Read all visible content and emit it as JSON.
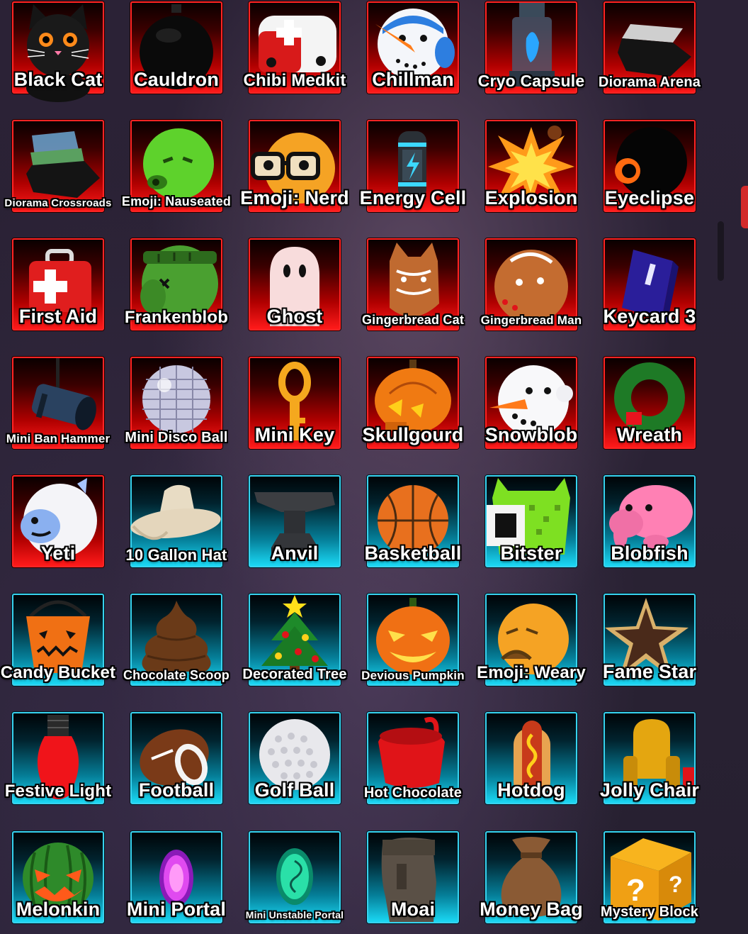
{
  "inventory": {
    "items": [
      {
        "label": "Black Cat",
        "icon": "black-cat-icon",
        "rarity": "red"
      },
      {
        "label": "Cauldron",
        "icon": "cauldron-icon",
        "rarity": "red"
      },
      {
        "label": "Chibi Medkit",
        "icon": "chibi-medkit-icon",
        "rarity": "red"
      },
      {
        "label": "Chillman",
        "icon": "chillman-icon",
        "rarity": "red"
      },
      {
        "label": "Cryo Capsule",
        "icon": "cryo-capsule-icon",
        "rarity": "red"
      },
      {
        "label": "Diorama Arena",
        "icon": "diorama-arena-icon",
        "rarity": "red"
      },
      {
        "label": "Diorama Crossroads",
        "icon": "diorama-crossroads-icon",
        "rarity": "red"
      },
      {
        "label": "Emoji: Nauseated",
        "icon": "emoji-nauseated-icon",
        "rarity": "red"
      },
      {
        "label": "Emoji: Nerd",
        "icon": "emoji-nerd-icon",
        "rarity": "red"
      },
      {
        "label": "Energy Cell",
        "icon": "energy-cell-icon",
        "rarity": "red"
      },
      {
        "label": "Explosion",
        "icon": "explosion-icon",
        "rarity": "red"
      },
      {
        "label": "Eyeclipse",
        "icon": "eyeclipse-icon",
        "rarity": "red"
      },
      {
        "label": "First Aid",
        "icon": "first-aid-icon",
        "rarity": "red"
      },
      {
        "label": "Frankenblob",
        "icon": "frankenblob-icon",
        "rarity": "red"
      },
      {
        "label": "Ghost",
        "icon": "ghost-icon",
        "rarity": "red"
      },
      {
        "label": "Gingerbread Cat",
        "icon": "gingerbread-cat-icon",
        "rarity": "red"
      },
      {
        "label": "Gingerbread Man",
        "icon": "gingerbread-man-icon",
        "rarity": "red"
      },
      {
        "label": "Keycard 3",
        "icon": "keycard-icon",
        "rarity": "red"
      },
      {
        "label": "Mini Ban Hammer",
        "icon": "ban-hammer-icon",
        "rarity": "red"
      },
      {
        "label": "Mini Disco Ball",
        "icon": "disco-ball-icon",
        "rarity": "red"
      },
      {
        "label": "Mini Key",
        "icon": "key-icon",
        "rarity": "red"
      },
      {
        "label": "Skullgourd",
        "icon": "skullgourd-icon",
        "rarity": "red"
      },
      {
        "label": "Snowblob",
        "icon": "snowblob-icon",
        "rarity": "red"
      },
      {
        "label": "Wreath",
        "icon": "wreath-icon",
        "rarity": "red"
      },
      {
        "label": "Yeti",
        "icon": "yeti-icon",
        "rarity": "red"
      },
      {
        "label": "10 Gallon Hat",
        "icon": "cowboy-hat-icon",
        "rarity": "blue"
      },
      {
        "label": "Anvil",
        "icon": "anvil-icon",
        "rarity": "blue"
      },
      {
        "label": "Basketball",
        "icon": "basketball-icon",
        "rarity": "blue"
      },
      {
        "label": "Bitster",
        "icon": "bitster-icon",
        "rarity": "blue"
      },
      {
        "label": "Blobfish",
        "icon": "blobfish-icon",
        "rarity": "blue"
      },
      {
        "label": "Candy Bucket",
        "icon": "candy-bucket-icon",
        "rarity": "blue"
      },
      {
        "label": "Chocolate Scoop",
        "icon": "chocolate-scoop-icon",
        "rarity": "blue"
      },
      {
        "label": "Decorated Tree",
        "icon": "christmas-tree-icon",
        "rarity": "blue"
      },
      {
        "label": "Devious Pumpkin",
        "icon": "devious-pumpkin-icon",
        "rarity": "blue"
      },
      {
        "label": "Emoji: Weary",
        "icon": "emoji-weary-icon",
        "rarity": "blue"
      },
      {
        "label": "Fame Star",
        "icon": "fame-star-icon",
        "rarity": "blue"
      },
      {
        "label": "Festive Light",
        "icon": "festive-light-icon",
        "rarity": "blue"
      },
      {
        "label": "Football",
        "icon": "football-icon",
        "rarity": "blue"
      },
      {
        "label": "Golf Ball",
        "icon": "golf-ball-icon",
        "rarity": "blue"
      },
      {
        "label": "Hot Chocolate",
        "icon": "hot-chocolate-icon",
        "rarity": "blue"
      },
      {
        "label": "Hotdog",
        "icon": "hotdog-icon",
        "rarity": "blue"
      },
      {
        "label": "Jolly Chair",
        "icon": "jolly-chair-icon",
        "rarity": "blue"
      },
      {
        "label": "Melonkin",
        "icon": "melonkin-icon",
        "rarity": "blue"
      },
      {
        "label": "Mini Portal",
        "icon": "mini-portal-icon",
        "rarity": "blue"
      },
      {
        "label": "Mini Unstable Portal",
        "icon": "unstable-portal-icon",
        "rarity": "blue"
      },
      {
        "label": "Moai",
        "icon": "moai-icon",
        "rarity": "blue"
      },
      {
        "label": "Money Bag",
        "icon": "money-bag-icon",
        "rarity": "blue"
      },
      {
        "label": "Mystery Block",
        "icon": "mystery-block-icon",
        "rarity": "blue"
      }
    ]
  },
  "colors": {
    "red_border": "#ff2424",
    "blue_border": "#38d2ef",
    "label_text": "#ffffff"
  }
}
